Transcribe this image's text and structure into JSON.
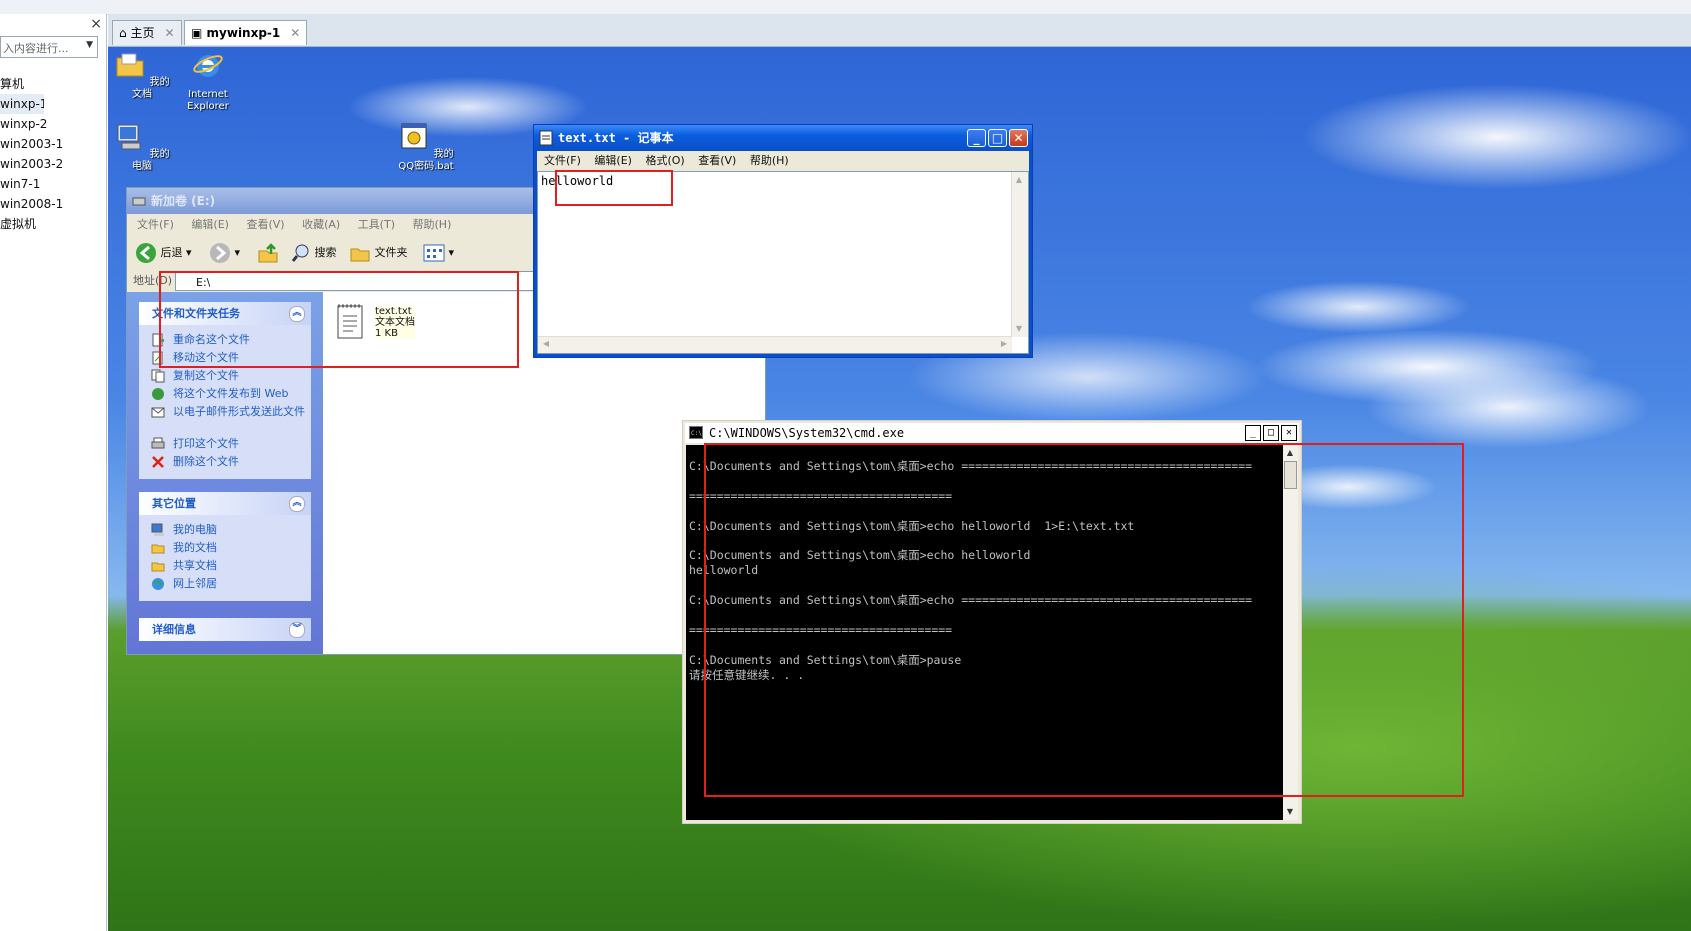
{
  "sidebar": {
    "search_placeholder": "入内容进行...",
    "items": [
      "算机",
      "winxp-1",
      "winxp-2",
      "win2003-1",
      "win2003-2",
      "win7-1",
      "win2008-1",
      "虚拟机"
    ]
  },
  "tabs": [
    {
      "label": "主页"
    },
    {
      "label": "mywinxp-1"
    }
  ],
  "desktop_icons": [
    {
      "label": "我的文档"
    },
    {
      "label": "Internet Explorer"
    },
    {
      "label": "我的电脑"
    },
    {
      "label": "我的QQ密码.bat"
    }
  ],
  "explorer": {
    "title": "新加卷 (E:)",
    "menu": [
      "文件(F)",
      "编辑(E)",
      "查看(V)",
      "收藏(A)",
      "工具(T)",
      "帮助(H)"
    ],
    "toolbar": {
      "back": "后退",
      "search": "搜索",
      "folders": "文件夹"
    },
    "address_label": "地址(D)",
    "address_value": "E:\\",
    "tasks_header": "文件和文件夹任务",
    "tasks": [
      "重命名这个文件",
      "移动这个文件",
      "复制这个文件",
      "将这个文件发布到 Web",
      "以电子邮件形式发送此文件",
      "打印这个文件",
      "删除这个文件"
    ],
    "places_header": "其它位置",
    "places": [
      "我的电脑",
      "我的文档",
      "共享文档",
      "网上邻居"
    ],
    "details_header": "详细信息",
    "file": {
      "name": "text.txt",
      "type": "文本文档",
      "size": "1 KB"
    }
  },
  "notepad": {
    "title": "text.txt - 记事本",
    "menu": [
      "文件(F)",
      "编辑(E)",
      "格式(O)",
      "查看(V)",
      "帮助(H)"
    ],
    "content": "helloworld"
  },
  "cmd": {
    "title": "C:\\WINDOWS\\System32\\cmd.exe",
    "lines": [
      "C:\\Documents and Settings\\tom\\桌面>echo ==========================================",
      "",
      "======================================",
      "",
      "C:\\Documents and Settings\\tom\\桌面>echo helloworld  1>E:\\text.txt",
      "",
      "C:\\Documents and Settings\\tom\\桌面>echo helloworld",
      "helloworld",
      "",
      "C:\\Documents and Settings\\tom\\桌面>echo ==========================================",
      "",
      "======================================",
      "",
      "C:\\Documents and Settings\\tom\\桌面>pause",
      "请按任意键继续. . ."
    ]
  },
  "colors": {
    "annotation": "#e02020",
    "xp_title": "#0a4fc8"
  }
}
